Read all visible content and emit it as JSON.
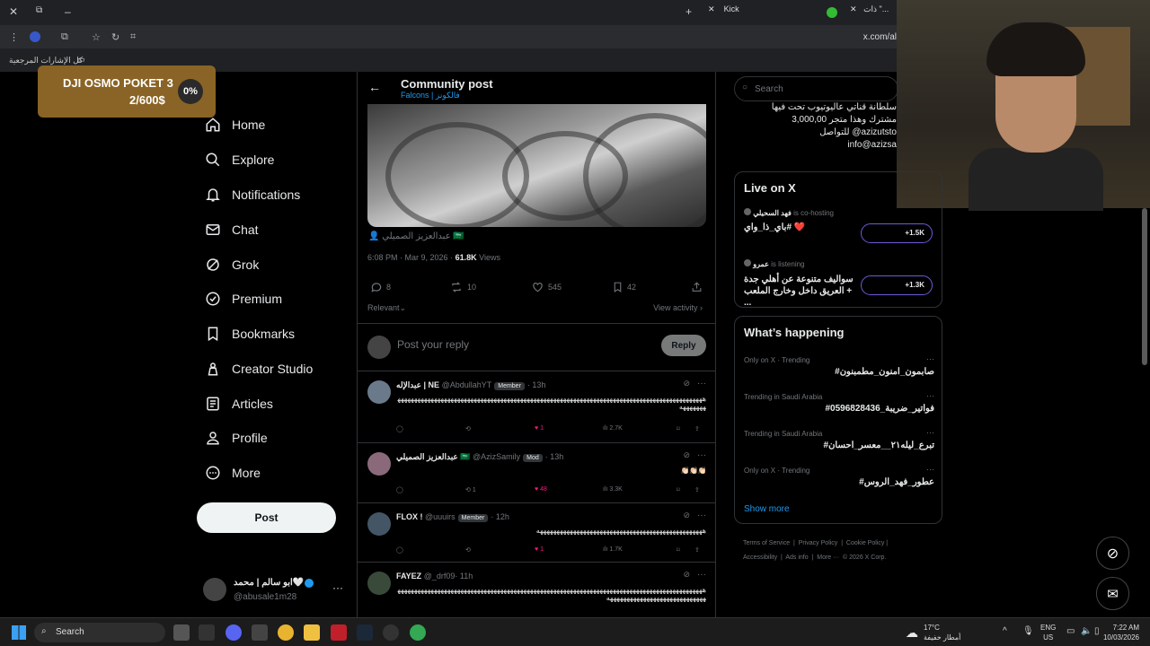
{
  "browser": {
    "tabs": [
      {
        "label": "Kick"
      },
      {
        "label": "ذات \"..."
      }
    ],
    "url": "x.com/al",
    "bookmarks_label": "كل الإشارات المرجعية"
  },
  "overlay": {
    "title": "DJI OSMO POKET 3",
    "amount": "2/600$",
    "percent": "0%",
    "progress": 0
  },
  "nav": {
    "items": [
      {
        "label": "Home",
        "icon": "home-icon"
      },
      {
        "label": "Explore",
        "icon": "search-icon"
      },
      {
        "label": "Notifications",
        "icon": "bell-icon"
      },
      {
        "label": "Chat",
        "icon": "mail-icon"
      },
      {
        "label": "Grok",
        "icon": "grok-icon"
      },
      {
        "label": "Premium",
        "icon": "verified-icon"
      },
      {
        "label": "Bookmarks",
        "icon": "bookmark-icon"
      },
      {
        "label": "Creator Studio",
        "icon": "creator-icon"
      },
      {
        "label": "Articles",
        "icon": "article-icon"
      },
      {
        "label": "Profile",
        "icon": "person-icon"
      },
      {
        "label": "More",
        "icon": "more-circle-icon"
      }
    ],
    "post_label": "Post",
    "account_name": "ابو سالم | محمد🤍",
    "account_handle": "@abusale1m28"
  },
  "header": {
    "title": "Community post",
    "subtitle": "Falcons | فالكونز"
  },
  "post": {
    "author": "عبدالعزيز الصميلي 🇸🇦",
    "time": "6:08 PM · Mar 9, 2026 ·",
    "views": "61.8K",
    "views_label": "Views",
    "replies": "8",
    "reposts": "10",
    "likes": "545",
    "bookmarks": "42",
    "sort_label": "Relevant",
    "view_activity": "View activity"
  },
  "reply_box": {
    "placeholder": "Post your reply",
    "button": "Reply"
  },
  "comments": [
    {
      "name": "عبدالإله | NE",
      "handle": "@AbdullahYT",
      "badge": "Member",
      "time": "· 13h",
      "text": "ههههههههههههههههههههههههههههههههههههههههههههههههههههههههههههههههههههههههههههههههههههههههههههههههههههه",
      "likes": "1",
      "views": "2.7K",
      "reposts": ""
    },
    {
      "name": "عبدالعزيز الصميلي 🇸🇦",
      "handle": "@AzizSamily",
      "badge": "Mod",
      "time": "· 13h",
      "text": "👏🏻👏🏻👏🏻",
      "likes": "48",
      "views": "3.3K",
      "reposts": "1"
    },
    {
      "name": "FLOX !",
      "handle": "@uuuirs",
      "badge": "Member",
      "time": "· 12h",
      "text": "ههههههههههههههههههههههههههههههههههههههههههههههههههه",
      "likes": "1",
      "views": "1.7K",
      "reposts": ""
    },
    {
      "name": "FAYEZ",
      "handle": "@_drf09",
      "badge": "",
      "time": "· 11h",
      "text": "ههههههههههههههههههههههههههههههههههههههههههههههههههههههههههههههههههههههههههههههههههههههههههههههههههههههههههههههههههههههههههه",
      "likes": "",
      "views": "",
      "reposts": ""
    }
  ],
  "right": {
    "search_placeholder": "Search",
    "bio_lines": [
      "سلطانة قناتي عاليوتيوب تحت فيها",
      "3,000,00 مشترك وهذا متجر",
      "للتواصل @azizutsto",
      "info@azizsa"
    ],
    "live_title": "Live on X",
    "live": [
      {
        "host": "فهد السحيلي",
        "status": "is co-hosting",
        "title": "باي_ذا_واي# ❤️",
        "count": "+1.5K"
      },
      {
        "host": "عمرو",
        "status": "is listening",
        "title": "سواليف متنوعة عن أهلي جدة + العريق داخل وخارج الملعب ...",
        "count": "+1.3K"
      }
    ],
    "happening_title": "What’s happening",
    "trends": [
      {
        "label": "Only on X · Trending",
        "tag": "#صابمون_امنون_مطمبنون"
      },
      {
        "label": "Trending in Saudi Arabia",
        "tag": "#فواتير_ضريبة_0596828436"
      },
      {
        "label": "Trending in Saudi Arabia",
        "tag": "#تبرع_ليله٢١__معسر_احسان"
      },
      {
        "label": "Only on X · Trending",
        "tag": "#عطور_فهد_الروس"
      }
    ],
    "show_more": "Show more",
    "footer": [
      "Terms of Service",
      "Privacy Policy",
      "Cookie Policy",
      "Accessibility",
      "Ads info",
      "More ···",
      "© 2026 X Corp."
    ]
  },
  "taskbar": {
    "search": "Search",
    "weather_temp": "17°C",
    "weather_desc": "أمطار خفيفة",
    "lang": "ENG",
    "region": "US",
    "time": "7:22 AM",
    "date": "10/03/2026"
  },
  "colors": {
    "accent": "#1d9bf0",
    "like": "#f91880",
    "overlay": "#8a6426",
    "live_border": "#6b5bd6"
  }
}
